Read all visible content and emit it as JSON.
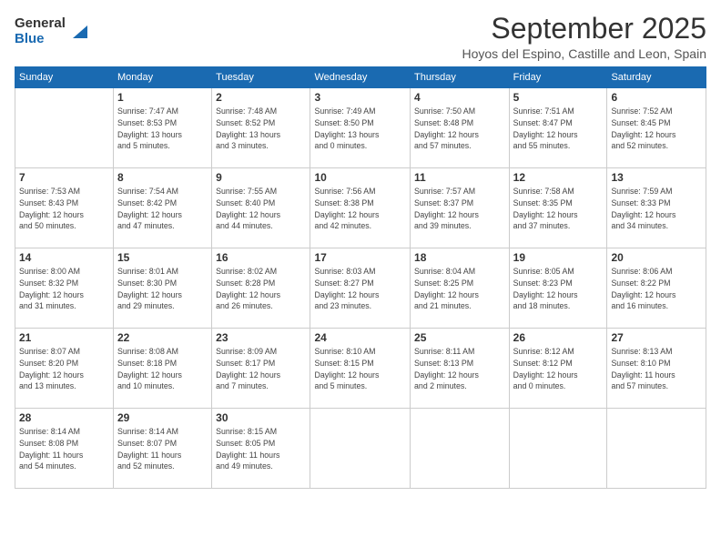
{
  "logo": {
    "general": "General",
    "blue": "Blue"
  },
  "title": "September 2025",
  "location": "Hoyos del Espino, Castille and Leon, Spain",
  "headers": [
    "Sunday",
    "Monday",
    "Tuesday",
    "Wednesday",
    "Thursday",
    "Friday",
    "Saturday"
  ],
  "weeks": [
    [
      {
        "day": "",
        "info": ""
      },
      {
        "day": "1",
        "info": "Sunrise: 7:47 AM\nSunset: 8:53 PM\nDaylight: 13 hours\nand 5 minutes."
      },
      {
        "day": "2",
        "info": "Sunrise: 7:48 AM\nSunset: 8:52 PM\nDaylight: 13 hours\nand 3 minutes."
      },
      {
        "day": "3",
        "info": "Sunrise: 7:49 AM\nSunset: 8:50 PM\nDaylight: 13 hours\nand 0 minutes."
      },
      {
        "day": "4",
        "info": "Sunrise: 7:50 AM\nSunset: 8:48 PM\nDaylight: 12 hours\nand 57 minutes."
      },
      {
        "day": "5",
        "info": "Sunrise: 7:51 AM\nSunset: 8:47 PM\nDaylight: 12 hours\nand 55 minutes."
      },
      {
        "day": "6",
        "info": "Sunrise: 7:52 AM\nSunset: 8:45 PM\nDaylight: 12 hours\nand 52 minutes."
      }
    ],
    [
      {
        "day": "7",
        "info": "Sunrise: 7:53 AM\nSunset: 8:43 PM\nDaylight: 12 hours\nand 50 minutes."
      },
      {
        "day": "8",
        "info": "Sunrise: 7:54 AM\nSunset: 8:42 PM\nDaylight: 12 hours\nand 47 minutes."
      },
      {
        "day": "9",
        "info": "Sunrise: 7:55 AM\nSunset: 8:40 PM\nDaylight: 12 hours\nand 44 minutes."
      },
      {
        "day": "10",
        "info": "Sunrise: 7:56 AM\nSunset: 8:38 PM\nDaylight: 12 hours\nand 42 minutes."
      },
      {
        "day": "11",
        "info": "Sunrise: 7:57 AM\nSunset: 8:37 PM\nDaylight: 12 hours\nand 39 minutes."
      },
      {
        "day": "12",
        "info": "Sunrise: 7:58 AM\nSunset: 8:35 PM\nDaylight: 12 hours\nand 37 minutes."
      },
      {
        "day": "13",
        "info": "Sunrise: 7:59 AM\nSunset: 8:33 PM\nDaylight: 12 hours\nand 34 minutes."
      }
    ],
    [
      {
        "day": "14",
        "info": "Sunrise: 8:00 AM\nSunset: 8:32 PM\nDaylight: 12 hours\nand 31 minutes."
      },
      {
        "day": "15",
        "info": "Sunrise: 8:01 AM\nSunset: 8:30 PM\nDaylight: 12 hours\nand 29 minutes."
      },
      {
        "day": "16",
        "info": "Sunrise: 8:02 AM\nSunset: 8:28 PM\nDaylight: 12 hours\nand 26 minutes."
      },
      {
        "day": "17",
        "info": "Sunrise: 8:03 AM\nSunset: 8:27 PM\nDaylight: 12 hours\nand 23 minutes."
      },
      {
        "day": "18",
        "info": "Sunrise: 8:04 AM\nSunset: 8:25 PM\nDaylight: 12 hours\nand 21 minutes."
      },
      {
        "day": "19",
        "info": "Sunrise: 8:05 AM\nSunset: 8:23 PM\nDaylight: 12 hours\nand 18 minutes."
      },
      {
        "day": "20",
        "info": "Sunrise: 8:06 AM\nSunset: 8:22 PM\nDaylight: 12 hours\nand 16 minutes."
      }
    ],
    [
      {
        "day": "21",
        "info": "Sunrise: 8:07 AM\nSunset: 8:20 PM\nDaylight: 12 hours\nand 13 minutes."
      },
      {
        "day": "22",
        "info": "Sunrise: 8:08 AM\nSunset: 8:18 PM\nDaylight: 12 hours\nand 10 minutes."
      },
      {
        "day": "23",
        "info": "Sunrise: 8:09 AM\nSunset: 8:17 PM\nDaylight: 12 hours\nand 7 minutes."
      },
      {
        "day": "24",
        "info": "Sunrise: 8:10 AM\nSunset: 8:15 PM\nDaylight: 12 hours\nand 5 minutes."
      },
      {
        "day": "25",
        "info": "Sunrise: 8:11 AM\nSunset: 8:13 PM\nDaylight: 12 hours\nand 2 minutes."
      },
      {
        "day": "26",
        "info": "Sunrise: 8:12 AM\nSunset: 8:12 PM\nDaylight: 12 hours\nand 0 minutes."
      },
      {
        "day": "27",
        "info": "Sunrise: 8:13 AM\nSunset: 8:10 PM\nDaylight: 11 hours\nand 57 minutes."
      }
    ],
    [
      {
        "day": "28",
        "info": "Sunrise: 8:14 AM\nSunset: 8:08 PM\nDaylight: 11 hours\nand 54 minutes."
      },
      {
        "day": "29",
        "info": "Sunrise: 8:14 AM\nSunset: 8:07 PM\nDaylight: 11 hours\nand 52 minutes."
      },
      {
        "day": "30",
        "info": "Sunrise: 8:15 AM\nSunset: 8:05 PM\nDaylight: 11 hours\nand 49 minutes."
      },
      {
        "day": "",
        "info": ""
      },
      {
        "day": "",
        "info": ""
      },
      {
        "day": "",
        "info": ""
      },
      {
        "day": "",
        "info": ""
      }
    ]
  ]
}
